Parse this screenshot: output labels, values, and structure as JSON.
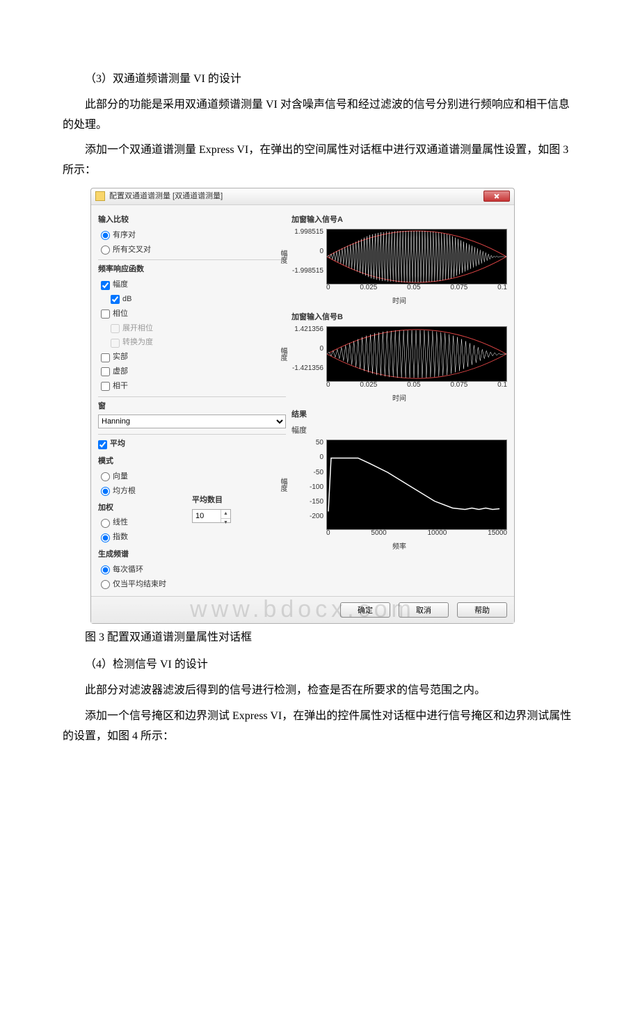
{
  "paragraphs": {
    "p1": "（3）双通道频谱测量 VI 的设计",
    "p2": "此部分的功能是采用双通道频谱测量 VI 对含噪声信号和经过滤波的信号分别进行频响应和相干信息的处理。",
    "p3": "添加一个双通道谱测量 Express VI，在弹出的空间属性对话框中进行双通道谱测量属性设置，如图 3 所示：",
    "caption_fig3": "图 3 配置双通道谱测量属性对话框",
    "p4": "（4）检测信号 VI 的设计",
    "p5": "此部分对滤波器滤波后得到的信号进行检测，检查是否在所要求的信号范围之内。",
    "p6": "添加一个信号掩区和边界测试 Express VI，在弹出的控件属性对话框中进行信号掩区和边界测试属性的设置，如图 4 所示："
  },
  "dialog": {
    "title": "配置双通道谱测量 [双通道谱测量]",
    "groups": {
      "input_compare": "输入比较",
      "freq_resp_fn": "频率响应函数",
      "window": "窗",
      "averaging": "平均",
      "mode": "模式",
      "weighting": "加权",
      "avg_count_label": "平均数目",
      "gen_spectrum": "生成频谱",
      "result": "结果"
    },
    "options": {
      "ordered_pair": "有序对",
      "all_cross_pair": "所有交叉对",
      "magnitude": "幅度",
      "dB": "dB",
      "phase": "相位",
      "unwrap_phase": "展开相位",
      "to_degrees": "转换为度",
      "real": "实部",
      "imag": "虚部",
      "coherent": "相干",
      "vector": "向量",
      "rms": "均方根",
      "linear": "线性",
      "exponential": "指数",
      "each_iteration": "每次循环",
      "avg_complete_only": "仅当平均结束时"
    },
    "window_select": "Hanning",
    "averaging_checked_label": "平均",
    "avg_count_value": "10",
    "chart_titles": {
      "inputA": "加窗输入信号A",
      "inputB": "加窗输入信号B",
      "result_mode": "幅度"
    },
    "axis_labels": {
      "amplitude_v": "幅度",
      "time": "时间",
      "freq": "频率"
    },
    "buttons": {
      "ok": "确定",
      "cancel": "取消",
      "help": "帮助"
    }
  },
  "watermark": "www.bdocx.com",
  "chart_data": [
    {
      "type": "line",
      "title": "加窗输入信号A",
      "x": [
        0,
        0.025,
        0.05,
        0.075,
        0.1
      ],
      "xlabel": "时间",
      "ylabel": "幅度",
      "ylim": [
        -1.998515,
        1.998515
      ],
      "y_ticks": [
        -1.998515,
        0,
        1.998515
      ],
      "description": "Dense white noisy waveform modulated by a Hann-window-shaped red envelope; amplitude peaks near ±2 around t≈0.05 and tapers to ~0 at t=0 and t=0.1."
    },
    {
      "type": "line",
      "title": "加窗输入信号B",
      "x": [
        0,
        0.025,
        0.05,
        0.075,
        0.1
      ],
      "xlabel": "时间",
      "ylabel": "幅度",
      "ylim": [
        -1.421356,
        1.421356
      ],
      "y_ticks": [
        -1.421356,
        0,
        1.421356
      ],
      "description": "Dense white noisy waveform modulated by a Hann-window-shaped red envelope; amplitude peaks near ±1.42 around t≈0.05 and tapers to ~0 at edges."
    },
    {
      "type": "line",
      "title": "结果 幅度",
      "xlabel": "频率",
      "ylabel": "幅度",
      "xlim": [
        0,
        15000
      ],
      "x_ticks": [
        0,
        5000,
        10000,
        15000
      ],
      "ylim": [
        -200,
        50
      ],
      "y_ticks": [
        -200,
        -150,
        -100,
        -50,
        0,
        50
      ],
      "series": [
        {
          "name": "magnitude",
          "values": [
            [
              0,
              -150
            ],
            [
              300,
              0
            ],
            [
              2500,
              0
            ],
            [
              3500,
              -15
            ],
            [
              5000,
              -40
            ],
            [
              7000,
              -80
            ],
            [
              9000,
              -120
            ],
            [
              10500,
              -140
            ],
            [
              11500,
              -145
            ],
            [
              12500,
              -140
            ],
            [
              13500,
              -145
            ]
          ]
        }
      ]
    }
  ]
}
